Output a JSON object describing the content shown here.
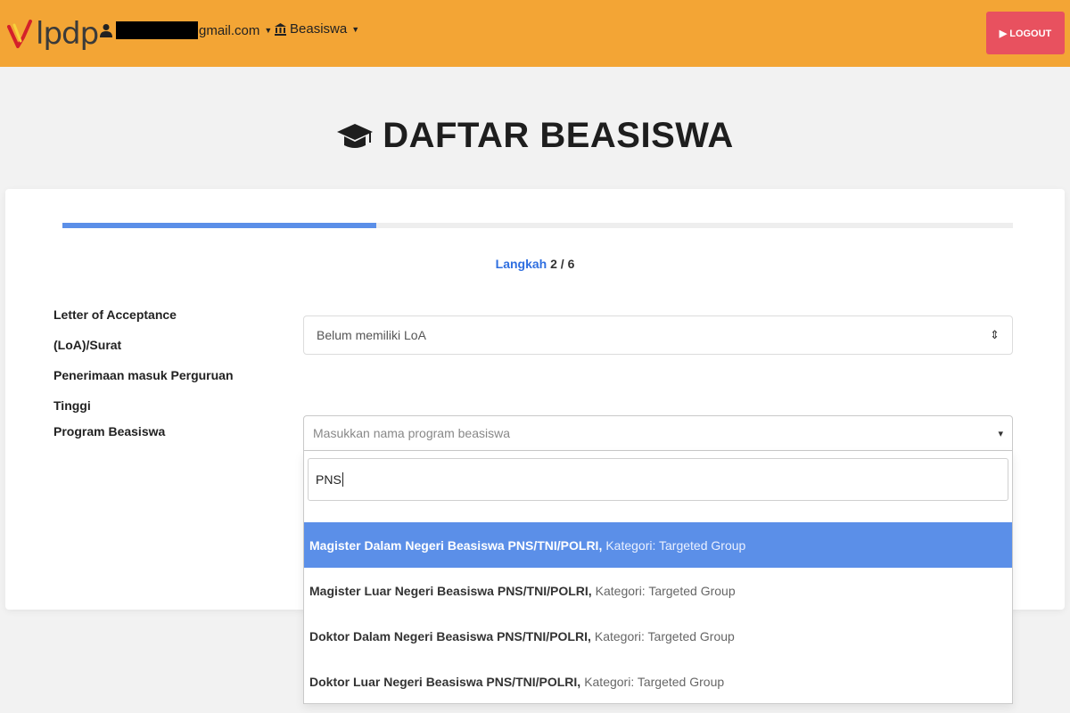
{
  "navbar": {
    "logo_text": "lpdp",
    "user_email_suffix": "gmail.com",
    "beasiswa_label": "Beasiswa",
    "logout_label": "▶ LOGOUT"
  },
  "page": {
    "title": "DAFTAR BEASISWA"
  },
  "progress": {
    "fraction": 0.33
  },
  "step": {
    "word": "Langkah",
    "value": "2 / 6"
  },
  "form": {
    "loa_label_line1": "Letter of Acceptance (LoA)/Surat",
    "loa_label_line2": "Penerimaan masuk Perguruan",
    "loa_label_line3": "Tinggi",
    "loa_value": "Belum memiliki LoA",
    "program_label": "Program Beasiswa",
    "program_placeholder": "Masukkan nama program beasiswa",
    "search_value": "PNS"
  },
  "options": [
    {
      "name": "Magister Dalam Negeri Beasiswa PNS/TNI/POLRI,",
      "category": "Kategori: Targeted Group"
    },
    {
      "name": "Magister Luar Negeri Beasiswa PNS/TNI/POLRI,",
      "category": "Kategori: Targeted Group"
    },
    {
      "name": "Doktor Dalam Negeri Beasiswa PNS/TNI/POLRI,",
      "category": "Kategori: Targeted Group"
    },
    {
      "name": "Doktor Luar Negeri Beasiswa PNS/TNI/POLRI,",
      "category": "Kategori: Targeted Group"
    }
  ],
  "colors": {
    "navbar": "#f3a535",
    "logout": "#e8515f",
    "accent": "#5b8fe8",
    "step_word": "#2f6fe0"
  }
}
